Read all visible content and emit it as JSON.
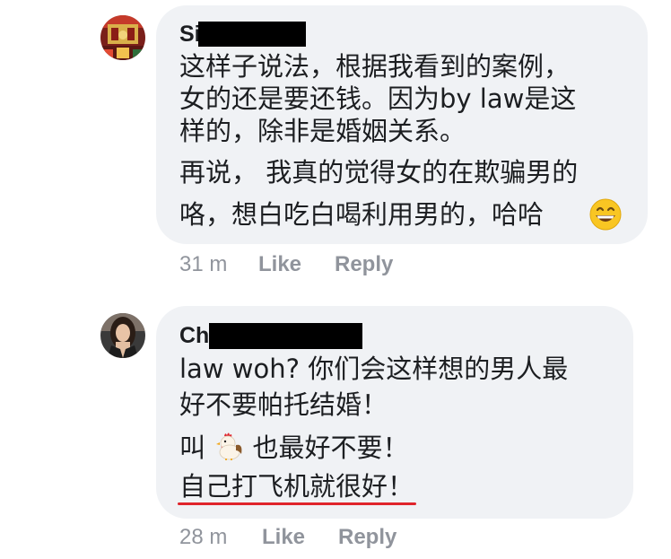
{
  "comments": [
    {
      "author": "Si",
      "lines": [
        "这样子说法，根据我看到的案例，",
        "女的还是要还钱。因为by law是这",
        "样的，除非是婚姻关系。",
        "再说， 我真的觉得女的在欺骗男的",
        "咯，想白吃白喝利用男的，哈哈"
      ],
      "emoji": "grinning-face",
      "time": "31 m",
      "like": "Like",
      "reply": "Reply"
    },
    {
      "author": "Ch",
      "lines": [
        "law woh?  你们会这样想的男人最",
        "好不要帕托结婚！"
      ],
      "line3_before": "叫",
      "line3_emoji": "rooster",
      "line3_after": "也最好不要！",
      "line4": "自己打飞机就很好！",
      "time": "28 m",
      "like": "Like",
      "reply": "Reply"
    }
  ],
  "colors": {
    "bubble": "#f0f2f5",
    "meta": "#90949c",
    "underline": "#e0242b",
    "redaction": "#000000"
  }
}
